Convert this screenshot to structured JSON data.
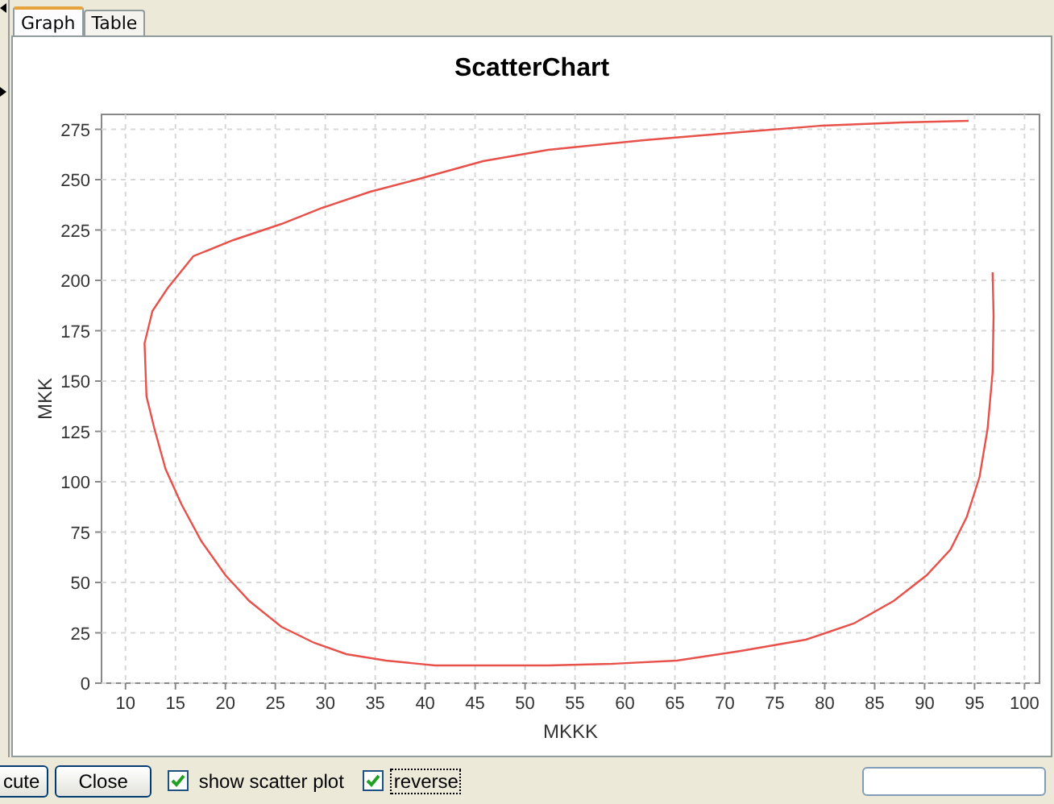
{
  "tabs": [
    {
      "label": "Graph",
      "selected": true
    },
    {
      "label": "Table",
      "selected": false
    }
  ],
  "chart": {
    "chart_data": {
      "type": "line",
      "grid": true,
      "title": "ScatterChart",
      "xlabel": "MKKK",
      "ylabel": "MKK",
      "xlim": [
        7.6,
        101.5
      ],
      "ylim": [
        0,
        282.4
      ],
      "xticks": [
        10,
        15,
        20,
        25,
        30,
        35,
        40,
        45,
        50,
        55,
        60,
        65,
        70,
        75,
        80,
        85,
        90,
        95,
        100
      ],
      "yticks": [
        0,
        25,
        50,
        75,
        100,
        125,
        150,
        175,
        200,
        225,
        250,
        275
      ],
      "x": [
        94.4,
        87.7,
        79.7,
        71.6,
        61.9,
        52.3,
        45.8,
        39.4,
        34.5,
        29.7,
        25.6,
        20.8,
        16.8,
        14.2,
        12.7,
        11.9,
        12.1,
        12.9,
        14.0,
        15.6,
        17.6,
        20.0,
        22.4,
        25.6,
        28.9,
        32.1,
        36.1,
        41.0,
        45.8,
        52.3,
        58.7,
        65.2,
        71.6,
        78.1,
        82.9,
        86.9,
        90.2,
        92.6,
        94.2,
        95.5,
        96.3,
        96.8,
        96.9,
        96.8
      ],
      "series": [
        {
          "color": "#e8504a",
          "values": [
            279.2,
            278.4,
            276.8,
            273.6,
            269.6,
            264.8,
            259.2,
            250.4,
            244,
            236,
            228,
            220,
            212,
            196,
            184.8,
            168.8,
            142.4,
            126.4,
            106.4,
            88.8,
            70.4,
            53.6,
            40.8,
            28,
            20,
            14.4,
            11.2,
            8.8,
            8.8,
            8.8,
            9.6,
            11.2,
            16,
            21.6,
            29.6,
            40.8,
            53.6,
            66.4,
            82.4,
            102.4,
            126.4,
            154.4,
            182.4,
            204
          ]
        }
      ]
    }
  },
  "buttons": [
    {
      "label": "cute"
    },
    {
      "label": "Close"
    }
  ],
  "checkboxes": [
    {
      "label": "show scatter plot",
      "checked": true,
      "focused": false
    },
    {
      "label": "reverse",
      "checked": true,
      "focused": true
    }
  ]
}
